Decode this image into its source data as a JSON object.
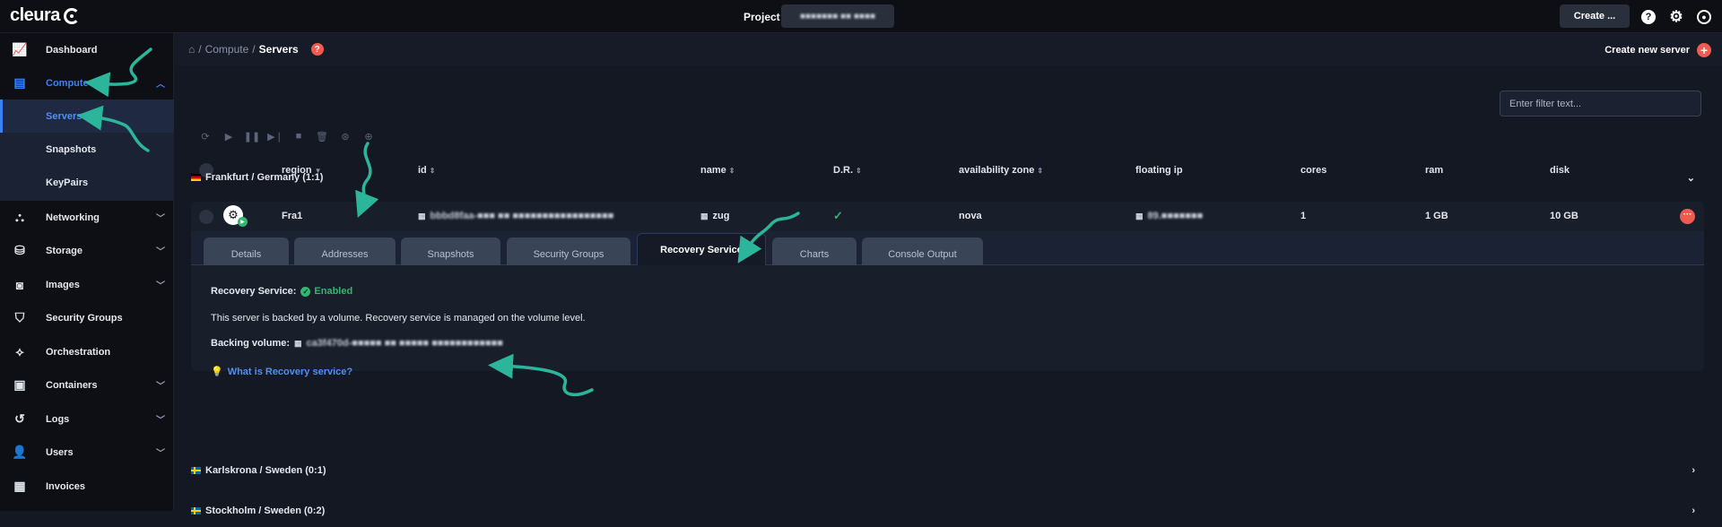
{
  "brand": "cleura",
  "topbar": {
    "project_label": "Project",
    "project_value": "■■■■■■■ ■■ ■■■■",
    "create_label": "Create ...",
    "icons": [
      "help-icon",
      "gear-icon",
      "user-icon"
    ]
  },
  "sidebar": {
    "items": [
      {
        "label": "Dashboard",
        "icon": "chart-icon"
      },
      {
        "label": "Compute",
        "icon": "server-icon"
      },
      {
        "label": "Networking",
        "icon": "network-icon"
      },
      {
        "label": "Storage",
        "icon": "storage-icon"
      },
      {
        "label": "Images",
        "icon": "camera-icon"
      },
      {
        "label": "Security Groups",
        "icon": "shield-icon"
      },
      {
        "label": "Orchestration",
        "icon": "orchestration-icon"
      },
      {
        "label": "Containers",
        "icon": "box-icon"
      },
      {
        "label": "Logs",
        "icon": "history-icon"
      },
      {
        "label": "Users",
        "icon": "user-icon"
      },
      {
        "label": "Invoices",
        "icon": "calculator-icon"
      }
    ],
    "compute_sub": [
      "Servers",
      "Snapshots",
      "KeyPairs"
    ]
  },
  "breadcrumb": {
    "section": "Compute",
    "current": "Servers"
  },
  "create_new_server": "Create new server",
  "filter_placeholder": "Enter filter text...",
  "columns": [
    "region",
    "id",
    "name",
    "D.R.",
    "availability zone",
    "floating ip",
    "cores",
    "ram",
    "disk"
  ],
  "groups": [
    {
      "label": "Frankfurt / Germany (1:1)",
      "flag": "de"
    },
    {
      "label": "Karlskrona / Sweden (0:1)",
      "flag": "se"
    },
    {
      "label": "Stockholm / Sweden (0:2)",
      "flag": "se"
    }
  ],
  "server": {
    "region": "Fra1",
    "id": "bbbd8faa-■■■ ■■ ■■■■■■■■■■■■■■■■■",
    "name": "zug",
    "availability_zone": "nova",
    "floating_ip": "89.■■■■■■■",
    "cores": "1",
    "ram": "1 GB",
    "disk": "10 GB"
  },
  "tabs": [
    "Details",
    "Addresses",
    "Snapshots",
    "Security Groups",
    "Recovery Service",
    "Charts",
    "Console Output"
  ],
  "active_tab": "Recovery Service",
  "recovery": {
    "label": "Recovery Service:",
    "status": "Enabled",
    "note": "This server is backed by a volume. Recovery service is managed on the volume level.",
    "backing_label": "Backing volume:",
    "backing_value": "ca3f470d-■■■■■ ■■ ■■■■■ ■■■■■■■■■■■■",
    "help_link": "What is Recovery service?"
  },
  "colors": {
    "accent": "#3b82f6",
    "danger": "#f05a4f",
    "success": "#2fb86f",
    "annotation": "#2bb59a"
  }
}
